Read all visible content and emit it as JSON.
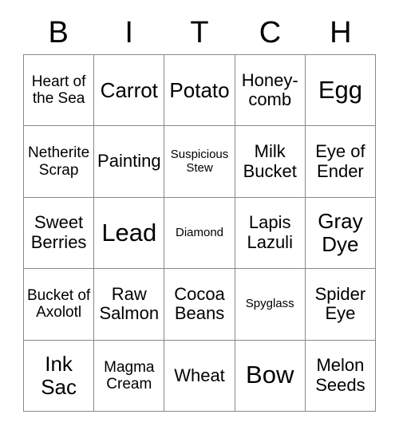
{
  "card": {
    "title_letters": [
      "B",
      "I",
      "T",
      "C",
      "H"
    ],
    "columns": 5,
    "rows": 5,
    "border_color": "#888888",
    "background_color": "#ffffff",
    "text_color": "#000000",
    "cells": [
      [
        {
          "label": "Heart of the Sea",
          "size": "sm"
        },
        {
          "label": "Carrot",
          "size": "lg"
        },
        {
          "label": "Potato",
          "size": "lg"
        },
        {
          "label": "Honey-comb",
          "size": "md"
        },
        {
          "label": "Egg",
          "size": "xl"
        }
      ],
      [
        {
          "label": "Netherite Scrap",
          "size": "sm"
        },
        {
          "label": "Painting",
          "size": "md"
        },
        {
          "label": "Suspicious Stew",
          "size": "xs"
        },
        {
          "label": "Milk Bucket",
          "size": "md"
        },
        {
          "label": "Eye of Ender",
          "size": "md"
        }
      ],
      [
        {
          "label": "Sweet Berries",
          "size": "md"
        },
        {
          "label": "Lead",
          "size": "xl"
        },
        {
          "label": "Diamond",
          "size": "xs"
        },
        {
          "label": "Lapis Lazuli",
          "size": "md"
        },
        {
          "label": "Gray Dye",
          "size": "lg"
        }
      ],
      [
        {
          "label": "Bucket of Axolotl",
          "size": "sm"
        },
        {
          "label": "Raw Salmon",
          "size": "md"
        },
        {
          "label": "Cocoa Beans",
          "size": "md"
        },
        {
          "label": "Spyglass",
          "size": "xs"
        },
        {
          "label": "Spider Eye",
          "size": "md"
        }
      ],
      [
        {
          "label": "Ink Sac",
          "size": "lg"
        },
        {
          "label": "Magma Cream",
          "size": "sm"
        },
        {
          "label": "Wheat",
          "size": "md"
        },
        {
          "label": "Bow",
          "size": "xl"
        },
        {
          "label": "Melon Seeds",
          "size": "md"
        }
      ]
    ]
  }
}
